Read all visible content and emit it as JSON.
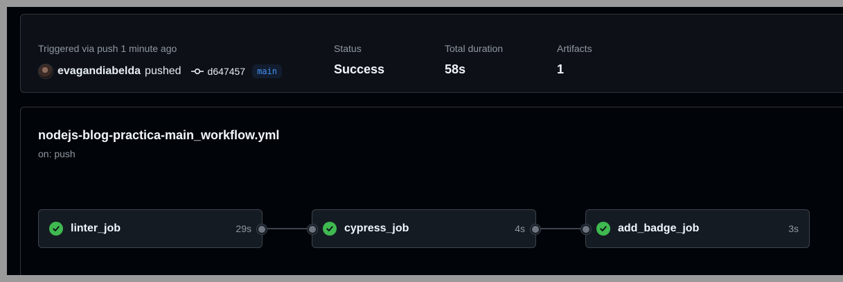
{
  "summary": {
    "trigger_label": "Triggered via push 1 minute ago",
    "user": "evagandiabelda",
    "action": "pushed",
    "commit_sha": "d647457",
    "branch": "main",
    "status_label": "Status",
    "status_value": "Success",
    "duration_label": "Total duration",
    "duration_value": "58s",
    "artifacts_label": "Artifacts",
    "artifacts_value": "1"
  },
  "workflow": {
    "title": "nodejs-blog-practica-main_workflow.yml",
    "trigger": "on: push",
    "jobs": [
      {
        "name": "linter_job",
        "duration": "29s",
        "status": "success"
      },
      {
        "name": "cypress_job",
        "duration": "4s",
        "status": "success"
      },
      {
        "name": "add_badge_job",
        "duration": "3s",
        "status": "success"
      }
    ]
  },
  "colors": {
    "success": "#3fb950",
    "branch_text": "#4493f8",
    "background": "#010409"
  }
}
